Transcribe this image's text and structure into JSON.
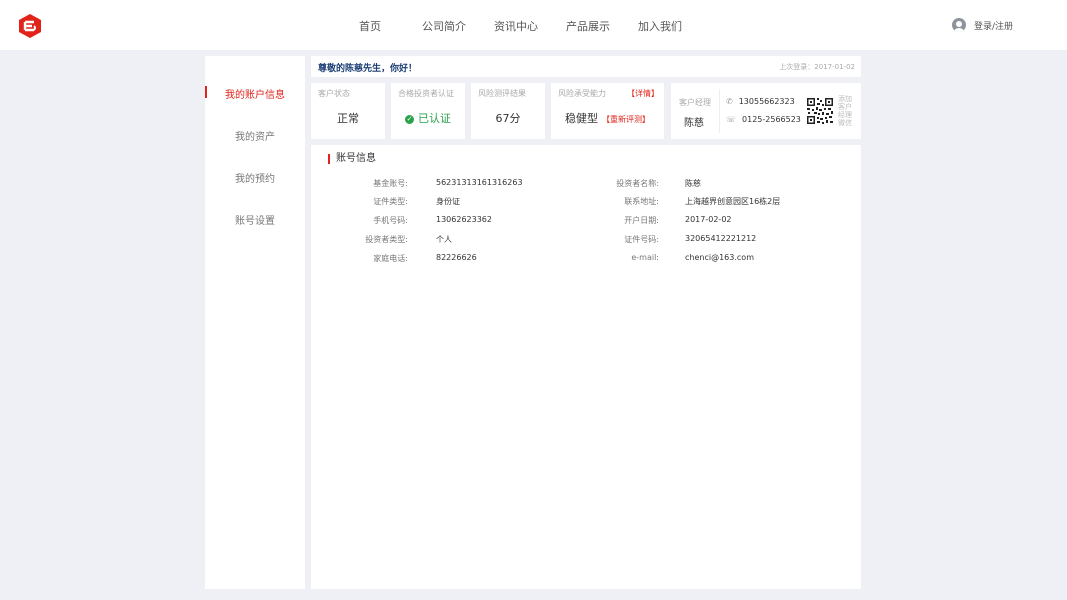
{
  "nav": {
    "items": [
      {
        "label": "首页"
      },
      {
        "label": "公司简介"
      },
      {
        "label": "资讯中心"
      },
      {
        "label": "产品展示"
      },
      {
        "label": "加入我们"
      }
    ],
    "login_label": "登录/注册"
  },
  "sidebar": {
    "items": [
      {
        "label": "我的账户信息",
        "active": true
      },
      {
        "label": "我的资产",
        "active": false
      },
      {
        "label": "我的预约",
        "active": false
      },
      {
        "label": "账号设置",
        "active": false
      }
    ]
  },
  "greeting": {
    "text": "尊敬的陈慈先生，你好！",
    "last_login": "上次登录：2017-01-02"
  },
  "cards": {
    "status": {
      "label": "客户状态",
      "value": "正常"
    },
    "qualified": {
      "label": "合格投资者认证",
      "value": "已认证"
    },
    "risk_test": {
      "label": "风险测评结果",
      "value": "67分"
    },
    "risk_tolerance": {
      "label": "风险承受能力",
      "link": "【详情】",
      "value": "稳健型",
      "retest": "【重新评测】"
    }
  },
  "manager": {
    "label": "客户经理",
    "name": "陈慈",
    "mobile": "13055662323",
    "phone": "0125-2566523",
    "qr_note": "添加客户经理微信"
  },
  "account": {
    "title": "账号信息",
    "left": [
      {
        "label": "基金账号:",
        "value": "56231313161316263"
      },
      {
        "label": "证件类型:",
        "value": "身份证"
      },
      {
        "label": "手机号码:",
        "value": "13062623362"
      },
      {
        "label": "投资者类型:",
        "value": "个人"
      },
      {
        "label": "家庭电话:",
        "value": "82226626"
      }
    ],
    "right": [
      {
        "label": "投资者名称:",
        "value": "陈慈"
      },
      {
        "label": "联系地址:",
        "value": "上海越界创意园区16栋2层"
      },
      {
        "label": "开户日期:",
        "value": "2017-02-02"
      },
      {
        "label": "证件号码:",
        "value": "32065412221212"
      },
      {
        "label": "e-mail:",
        "value": "chenci@163.com"
      }
    ]
  },
  "colors": {
    "accent": "#e2231a",
    "greeting": "#1b3d73",
    "verified": "#2aa24b"
  }
}
